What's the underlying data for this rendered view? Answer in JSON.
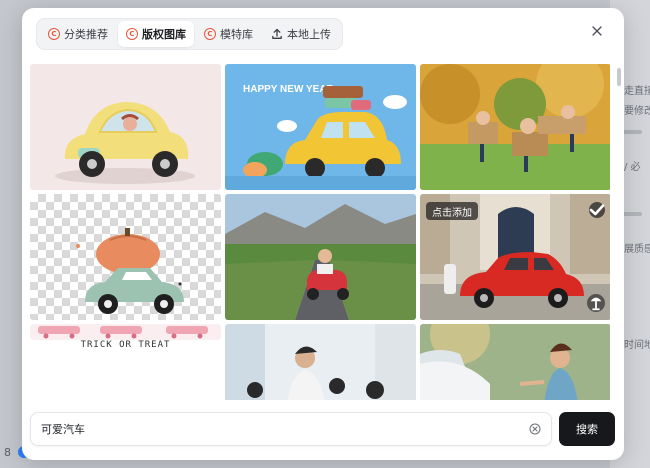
{
  "backdrop": {
    "right_texts": [
      "走直接",
      "要修改",
      "/ 必",
      "展质感",
      "时间地"
    ],
    "left_number": "8"
  },
  "tabs": [
    {
      "label": "分类推荐",
      "icon": "copyright-icon",
      "active": false
    },
    {
      "label": "版权图库",
      "icon": "copyright-icon",
      "active": true
    },
    {
      "label": "模特库",
      "icon": "copyright-icon",
      "active": false
    },
    {
      "label": "本地上传",
      "icon": "upload-icon",
      "active": false
    }
  ],
  "images": [
    {
      "name": "yellow-toy-car"
    },
    {
      "name": "happy-new-year-car",
      "text": "HAPPY NEW YEAR"
    },
    {
      "name": "kids-cardboard-planes"
    },
    {
      "name": "pumpkin-car-sticker",
      "text": "TRICK OR TREAT"
    },
    {
      "name": "child-pedal-car"
    },
    {
      "name": "red-fiat-car",
      "badge": "点击添加"
    },
    {
      "name": "pink-car-strip"
    },
    {
      "name": "office-kid-scene"
    },
    {
      "name": "girl-splash-car"
    }
  ],
  "search": {
    "value": "可爱汽车",
    "button_label": "搜索"
  },
  "colors": {
    "accent": "#e8563a",
    "button_dark": "#17181c"
  }
}
